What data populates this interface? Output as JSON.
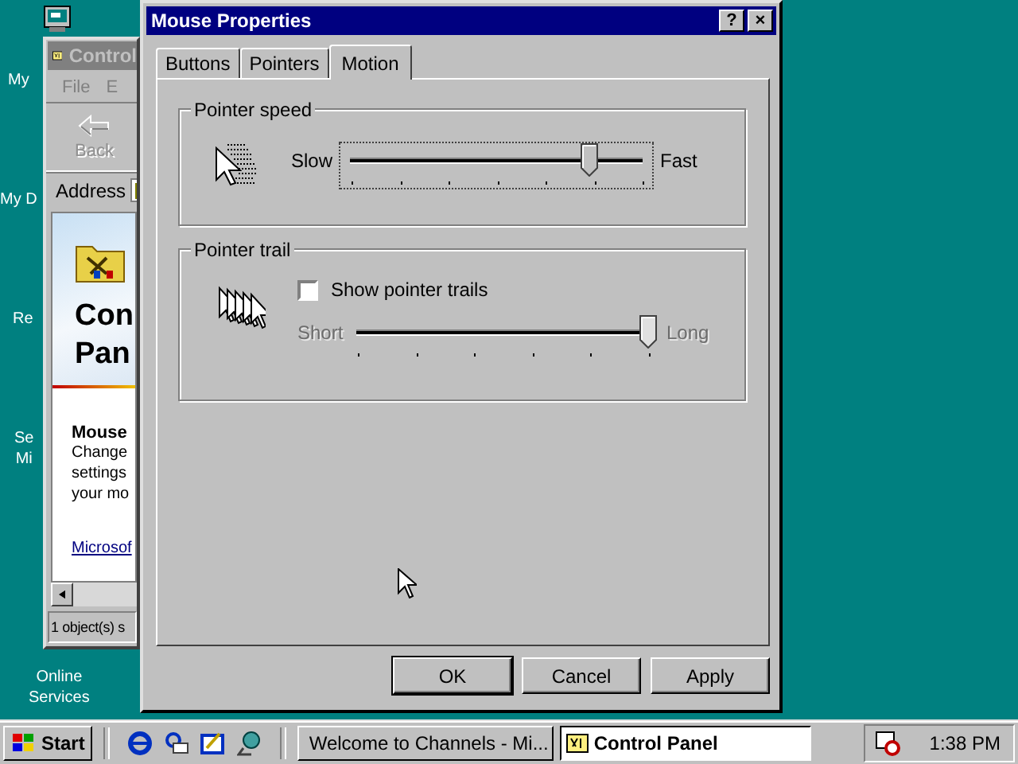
{
  "desktop_icons": [
    {
      "lines": [
        "My"
      ]
    },
    {
      "lines": [
        "My D"
      ]
    },
    {
      "lines": [
        "Re"
      ]
    },
    {
      "lines": [
        "Se",
        "Mi"
      ]
    },
    {
      "lines": [
        "Online",
        "Services"
      ]
    }
  ],
  "background_window": {
    "title": "Control",
    "menu": [
      "File",
      "E"
    ],
    "back_button": {
      "label": "Back",
      "disabled": true
    },
    "address_label": "Address",
    "heading_lines": [
      "Con",
      "Pan"
    ],
    "item_title": "Mouse",
    "item_lines": [
      "Change",
      "settings",
      "your mo"
    ],
    "link": "Microsof",
    "status": "1 object(s) s"
  },
  "dialog": {
    "title": "Mouse Properties",
    "help_button": "?",
    "close_button": "×",
    "tabs": [
      {
        "label": "Buttons",
        "selected": false
      },
      {
        "label": "Pointers",
        "selected": false
      },
      {
        "label": "Motion",
        "selected": true
      }
    ],
    "groups": [
      {
        "title": "Pointer speed",
        "kind": "speed",
        "slider": {
          "min_label": "Slow",
          "max_label": "Fast",
          "level": 0.82,
          "disabled": false,
          "focused": true
        }
      },
      {
        "title": "Pointer trail",
        "kind": "trail",
        "checkbox": {
          "label": "Show pointer trails",
          "checked": false
        },
        "slider": {
          "min_label": "Short",
          "max_label": "Long",
          "level": 1.0,
          "disabled": true,
          "focused": false
        }
      }
    ],
    "buttons": [
      "OK",
      "Cancel",
      "Apply"
    ]
  },
  "taskbar": {
    "start": "Start",
    "tasks": [
      {
        "label": "Welcome to Channels - Mi...",
        "selected": false
      },
      {
        "label": "Control Panel",
        "selected": true
      }
    ],
    "clock": "1:38 PM"
  }
}
